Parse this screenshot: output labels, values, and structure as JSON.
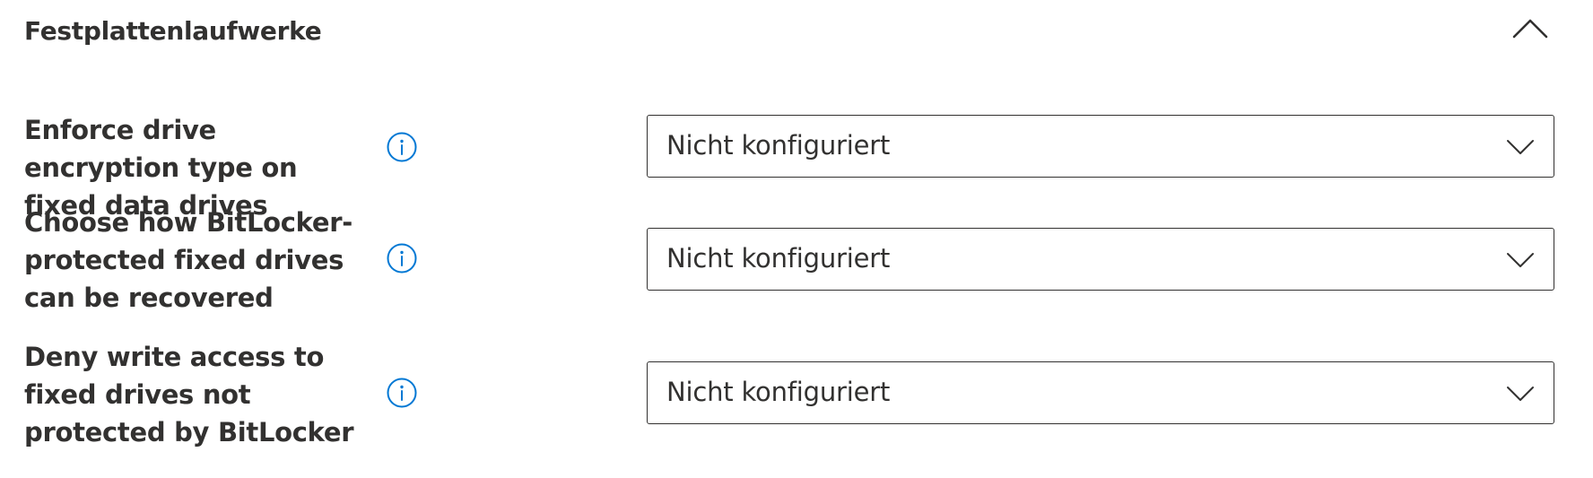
{
  "section": {
    "title": "Festplattenlaufwerke",
    "collapse_icon": "chevron-up-icon"
  },
  "settings": [
    {
      "label": "Enforce drive encryption type on fixed data drives",
      "info_icon": "info-icon",
      "dropdown_value": "Nicht konfiguriert",
      "dropdown_icon": "chevron-down-icon"
    },
    {
      "label": "Choose how BitLocker-protected fixed drives can be recovered",
      "info_icon": "info-icon",
      "dropdown_value": "Nicht konfiguriert",
      "dropdown_icon": "chevron-down-icon"
    },
    {
      "label": "Deny write access to fixed drives not protected by BitLocker",
      "info_icon": "info-icon",
      "dropdown_value": "Nicht konfiguriert",
      "dropdown_icon": "chevron-down-icon"
    }
  ],
  "colors": {
    "text": "#323130",
    "accent": "#0078d4",
    "border": "#323130",
    "background": "#ffffff"
  }
}
